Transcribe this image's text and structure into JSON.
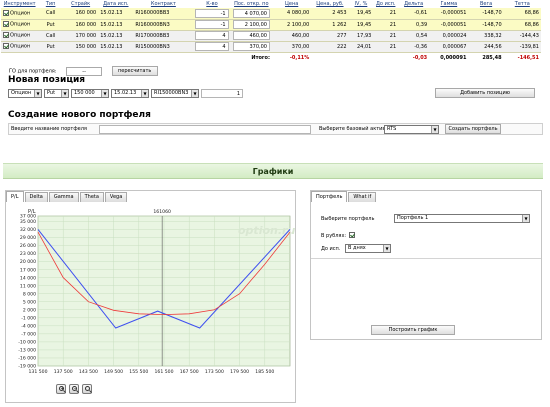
{
  "positions": {
    "columns": [
      "Инструмент",
      "Тип",
      "Страйк",
      "Дата исп.",
      "Контракт",
      "К-во",
      "Пос. откр. по",
      "Цена",
      "Цена, руб.",
      "IV, %",
      "До исп.",
      "Дельта",
      "Гамма",
      "Вега",
      "Тетта"
    ],
    "rows": [
      {
        "instrument": "Опцион",
        "type": "Call",
        "strike": "160 000",
        "date": "15.02.13",
        "contract": "RI160000BB3",
        "qty": "-1",
        "open": "4 070,00",
        "price": "4 080,00",
        "price_rub": "2 453",
        "iv": "19,45",
        "days": "21",
        "delta": "-0,61",
        "gamma": "-0,000051",
        "vega": "-148,70",
        "theta": "68,86",
        "checked": true,
        "style": "yellow"
      },
      {
        "instrument": "Опцион",
        "type": "Put",
        "strike": "160 000",
        "date": "15.02.13",
        "contract": "RI160000BN3",
        "qty": "-1",
        "open": "2 100,00",
        "price": "2 100,00",
        "price_rub": "1 262",
        "iv": "19,45",
        "days": "21",
        "delta": "0,39",
        "gamma": "-0,000051",
        "vega": "-148,70",
        "theta": "68,86",
        "checked": true,
        "style": "yellow"
      },
      {
        "instrument": "Опцион",
        "type": "Call",
        "strike": "170 000",
        "date": "15.02.13",
        "contract": "RI170000BB3",
        "qty": "4",
        "open": "460,00",
        "price": "460,00",
        "price_rub": "277",
        "iv": "17,93",
        "days": "21",
        "delta": "0,54",
        "gamma": "0,000024",
        "vega": "338,32",
        "theta": "-144,43",
        "checked": true,
        "style": "gray"
      },
      {
        "instrument": "Опцион",
        "type": "Put",
        "strike": "150 000",
        "date": "15.02.13",
        "contract": "RI150000BN3",
        "qty": "4",
        "open": "370,00",
        "price": "370,00",
        "price_rub": "222",
        "iv": "24,01",
        "days": "21",
        "delta": "-0,36",
        "gamma": "0,000067",
        "vega": "244,56",
        "theta": "-139,81",
        "checked": true,
        "style": "gray"
      }
    ],
    "total": {
      "label": "Итого:",
      "pct": "-0,11%",
      "delta": "-0,03",
      "gamma": "0,000091",
      "vega": "285,48",
      "theta": "-146,51"
    }
  },
  "go": {
    "label": "ГО для портфеля:",
    "value": "--",
    "button": "пересчитать"
  },
  "new_position": {
    "title": "Новая позиция",
    "instrument": "Опцион",
    "type": "Put",
    "strike": "150 000",
    "date": "15.02.13",
    "contract": "RI150000BN3",
    "qty": "1",
    "button": "Добавить позицию"
  },
  "new_portfolio": {
    "title": "Создание нового портфеля",
    "name_label": "Введите название портфеля",
    "asset_label": "Выберите базовый актив",
    "asset_value": "RTS",
    "button": "Создать портфель"
  },
  "charts_header": "Графики",
  "chart_tabs": [
    "P/L",
    "Delta",
    "Gamma",
    "Theta",
    "Vega"
  ],
  "right_tabs": [
    "Портфель",
    "What if"
  ],
  "right_panel": {
    "portfolio_label": "Выберите портфель",
    "portfolio_value": "Портфель 1",
    "rub_label": "В рублях:",
    "days_label": "До исп.",
    "days_value": "В днях",
    "button": "Построить график"
  },
  "watermark": "option.ru",
  "current_price_label": "161060",
  "colors": {
    "series_blue": "#3e4ff0",
    "series_red": "#ee3a3a",
    "plot_bg": "#e9f5e2",
    "grid": "#c9dfc0"
  },
  "chart_data": {
    "type": "line",
    "title": "P/L",
    "xlabel": "",
    "ylabel": "",
    "xlim": [
      131500,
      191500
    ],
    "ylim": [
      -19000,
      37000
    ],
    "x_ticks": [
      "131 500",
      "137 500",
      "143 500",
      "149 500",
      "155 500",
      "161 500",
      "167 500",
      "173 500",
      "179 500",
      "185 500"
    ],
    "x_tick_values": [
      131500,
      137500,
      143500,
      149500,
      155500,
      161500,
      167500,
      173500,
      179500,
      185500
    ],
    "y_ticks": [
      "37 000",
      "35 000",
      "32 000",
      "29 000",
      "26 000",
      "23 000",
      "20 000",
      "17 000",
      "14 000",
      "11 000",
      "8 000",
      "5 000",
      "2 000",
      "-1 000",
      "-4 000",
      "-7 000",
      "-10 000",
      "-13 000",
      "-16 000",
      "-19 000"
    ],
    "y_tick_values": [
      37000,
      35000,
      32000,
      29000,
      26000,
      23000,
      20000,
      17000,
      14000,
      11000,
      8000,
      5000,
      2000,
      -1000,
      -4000,
      -7000,
      -10000,
      -13000,
      -16000,
      -19000
    ],
    "current_x": 161060,
    "series": [
      {
        "x": [
          131500,
          150000,
          160000,
          170000,
          191500
        ],
        "y": [
          32000,
          -4800,
          1500,
          -4800,
          32000
        ]
      },
      {
        "x": [
          131500,
          137500,
          143500,
          149500,
          155500,
          161500,
          167500,
          173500,
          179500,
          185500,
          191500
        ],
        "y": [
          31000,
          14000,
          5000,
          1800,
          500,
          200,
          500,
          2000,
          8000,
          19000,
          31000
        ]
      }
    ]
  }
}
